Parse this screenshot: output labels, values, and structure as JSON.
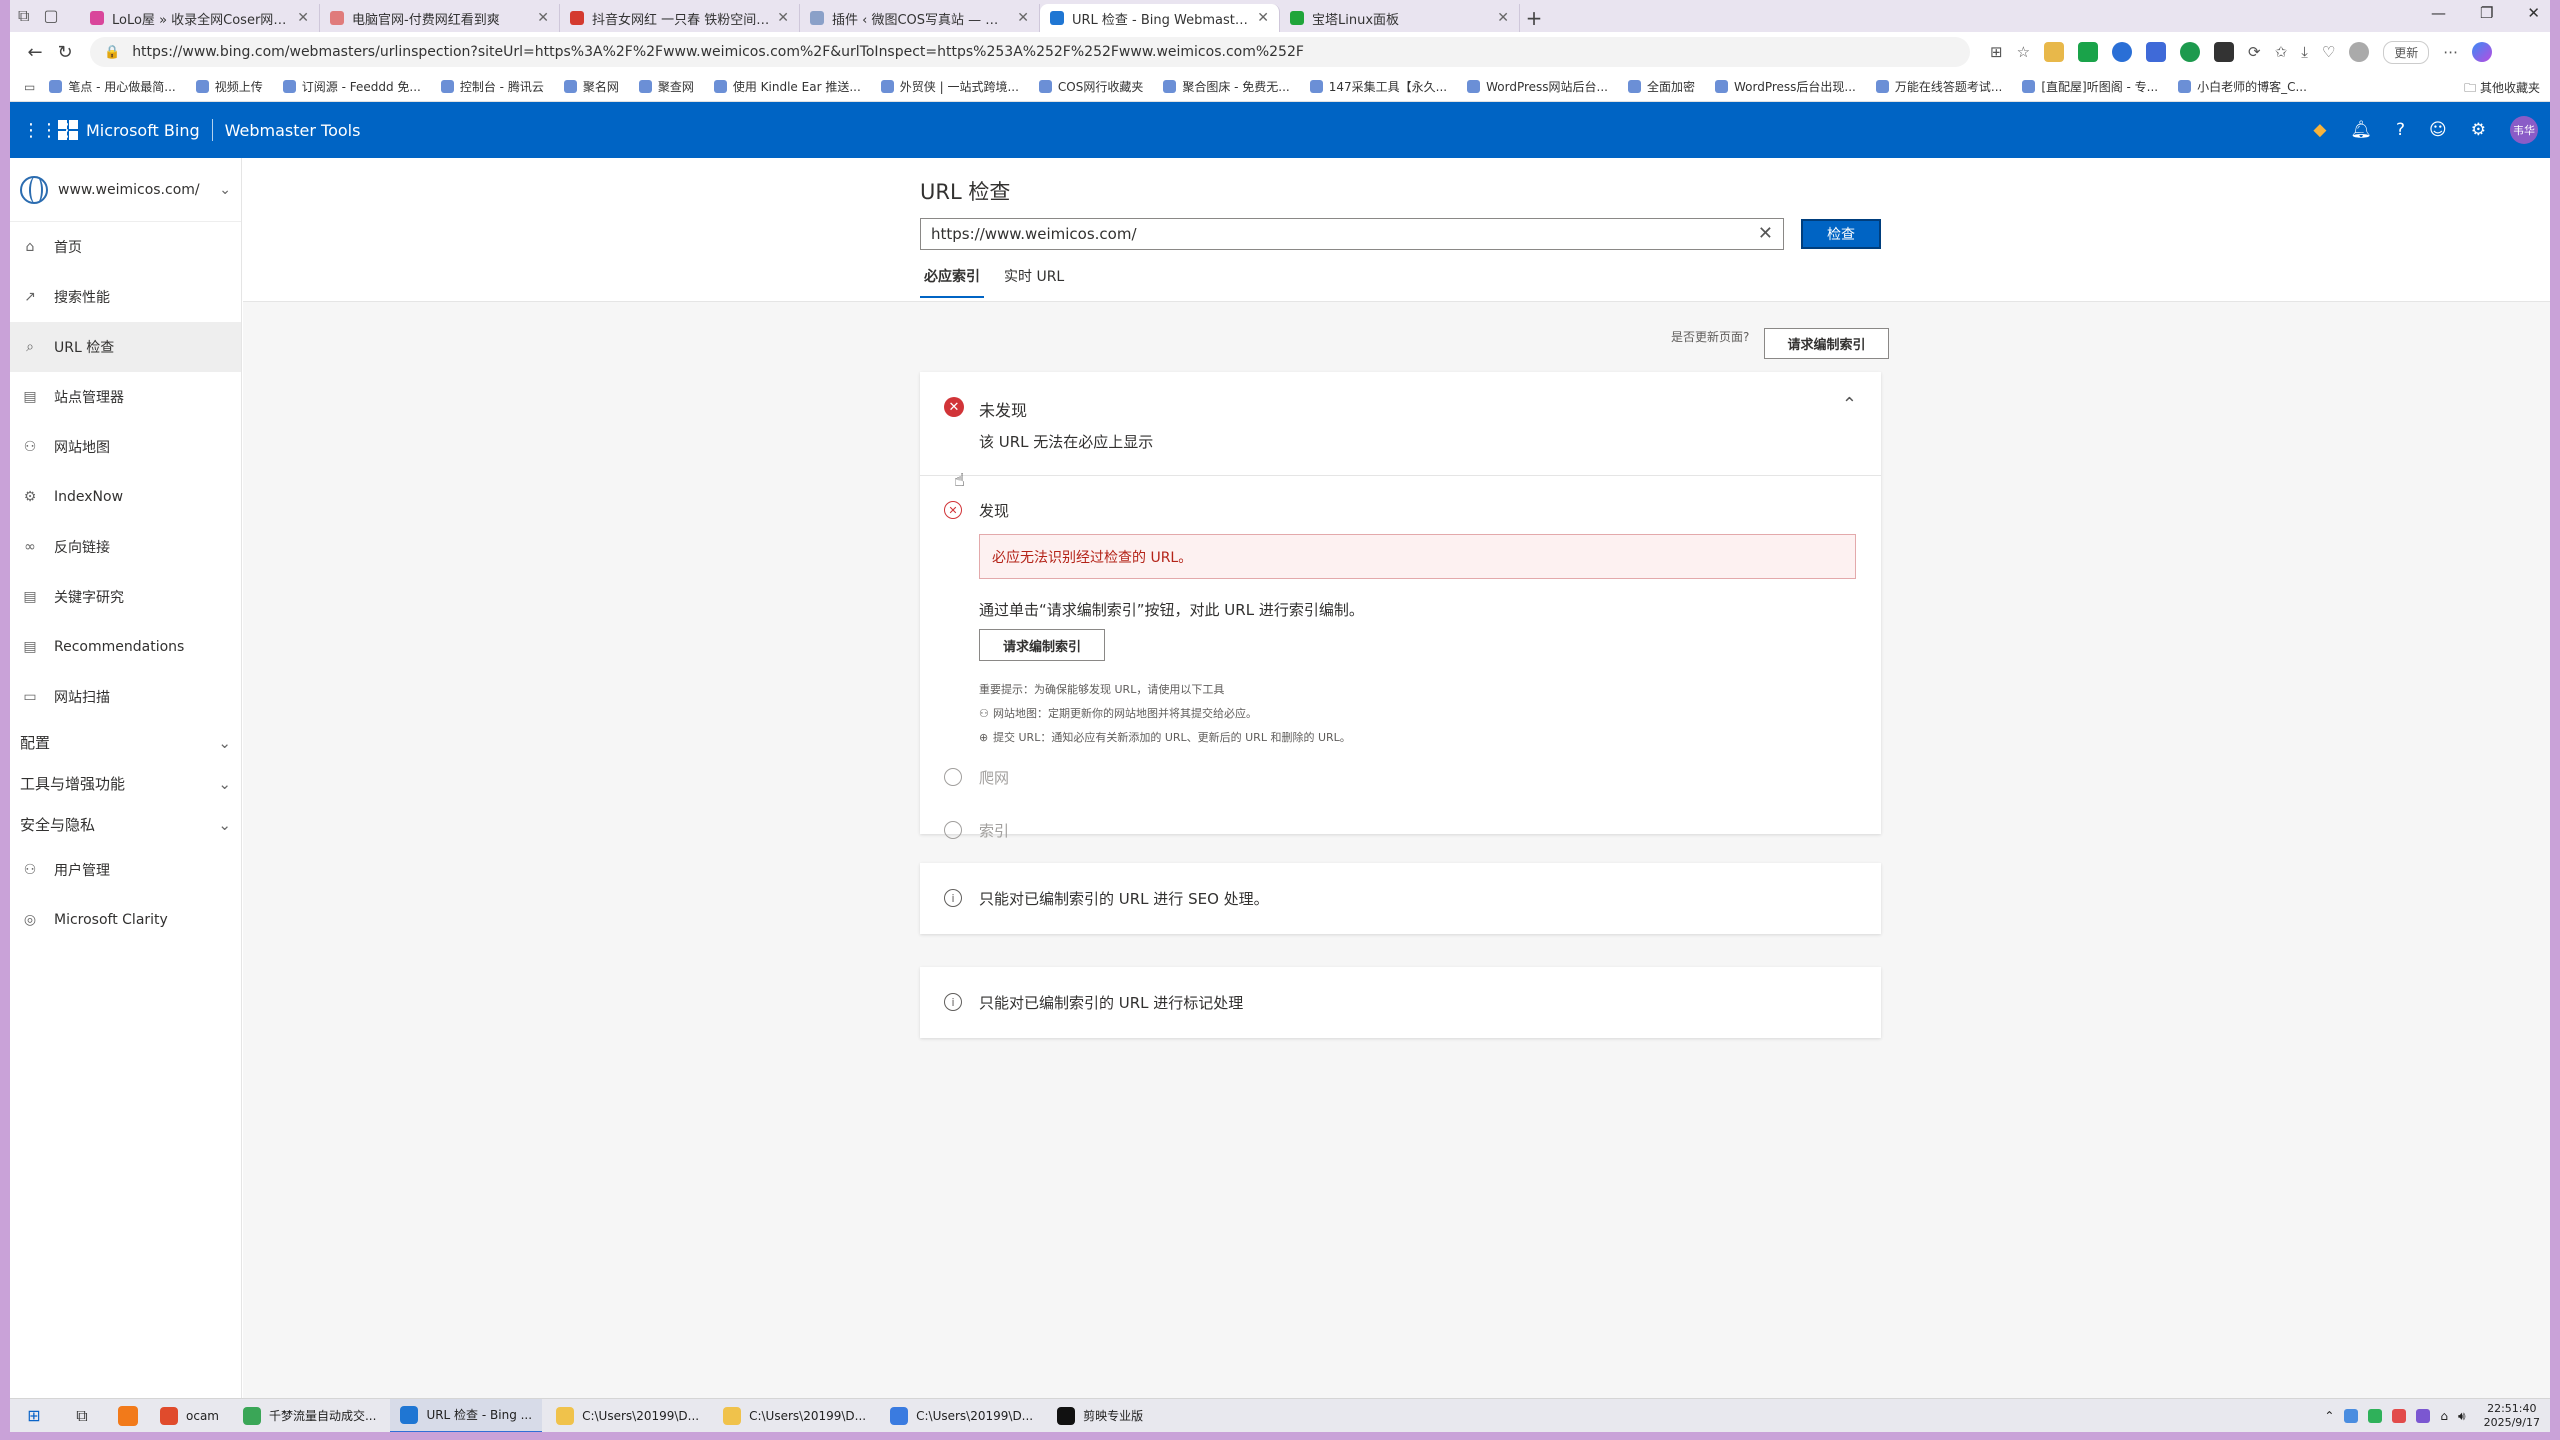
{
  "browser": {
    "tabs": [
      {
        "title": "LoLo屋 » 收录全网Coser网红写真",
        "color": "#d9469b",
        "active": false
      },
      {
        "title": "电脑官网-付费网红看到爽",
        "color": "#e07b7b",
        "active": false
      },
      {
        "title": "抖音女网红 一只春 铁粉空间 NO",
        "color": "#d43a2f",
        "active": false
      },
      {
        "title": "插件 ‹ 微图COS写真站 — WordPr",
        "color": "#8aa0c8",
        "active": false
      },
      {
        "title": "URL 检查 - Bing Webmaster Tools",
        "color": "#1f76d3",
        "active": true
      },
      {
        "title": "宝塔Linux面板",
        "color": "#20a53a",
        "active": false
      }
    ],
    "address": "https://www.bing.com/webmasters/urlinspection?siteUrl=https%3A%2F%2Fwww.weimicos.com%2F&urlToInspect=https%253A%252F%252Fwww.weimicos.com%252F",
    "update_label": "更新",
    "bookmarks": [
      "笔点 - 用心做最简...",
      "视频上传",
      "订阅源 - Feeddd 免...",
      "控制台 - 腾讯云",
      "聚名网",
      "聚查网",
      "使用 Kindle Ear 推送...",
      "外贸侠 | 一站式跨境...",
      "COS网行收藏夹",
      "聚合图床 - 免费无...",
      "147采集工具【永久...",
      "WordPress网站后台...",
      "全面加密",
      "WordPress后台出现...",
      "万能在线答题考试...",
      "[直配屋]听图阁 - 专...",
      "小白老师的博客_C..."
    ],
    "other_bookmarks": "其他收藏夹"
  },
  "header": {
    "brand": "Microsoft Bing",
    "product": "Webmaster Tools",
    "avatar_text": "韦华"
  },
  "sidebar": {
    "site": "www.weimicos.com/",
    "items": [
      {
        "label": "首页",
        "icon": "⌂",
        "active": false
      },
      {
        "label": "搜索性能",
        "icon": "↗",
        "active": false
      },
      {
        "label": "URL 检查",
        "icon": "⌕",
        "active": true
      },
      {
        "label": "站点管理器",
        "icon": "▤",
        "active": false
      },
      {
        "label": "网站地图",
        "icon": "⚇",
        "active": false
      },
      {
        "label": "IndexNow",
        "icon": "⚙",
        "active": false
      },
      {
        "label": "反向链接",
        "icon": "∞",
        "active": false
      },
      {
        "label": "关键字研究",
        "icon": "▤",
        "active": false
      },
      {
        "label": "Recommendations",
        "icon": "▤",
        "active": false
      },
      {
        "label": "网站扫描",
        "icon": "▭",
        "active": false
      }
    ],
    "groups": [
      "配置",
      "工具与增强功能",
      "安全与隐私"
    ],
    "bottom_items": [
      {
        "label": "用户管理",
        "icon": "⚇"
      },
      {
        "label": "Microsoft Clarity",
        "icon": "◎"
      }
    ]
  },
  "main": {
    "title": "URL 检查",
    "url_value": "https://www.weimicos.com/",
    "inspect_label": "检查",
    "tabs": [
      {
        "label": "必应索引",
        "active": true
      },
      {
        "label": "实时 URL",
        "active": false
      }
    ],
    "updated_question": "是否更新页面?",
    "request_index_label": "请求编制索引",
    "status_title": "未发现",
    "status_sub": "该 URL 无法在必应上显示",
    "steps": {
      "discovery": "发现",
      "crawl": "爬网",
      "index": "索引"
    },
    "error_message": "必应无法识别经过检查的 URL。",
    "description": "通过单击“请求编制索引”按钮，对此 URL 进行索引编制。",
    "tips": [
      "重要提示：为确保能够发现 URL，请使用以下工具",
      "网站地图：定期更新你的网站地图并将其提交给必应。",
      "提交 URL：通知必应有关新添加的 URL、更新后的 URL 和删除的 URL。"
    ],
    "info_seo": "只能对已编制索引的 URL 进行 SEO 处理。",
    "info_markup": "只能对已编制索引的 URL 进行标记处理"
  },
  "taskbar": {
    "apps": [
      {
        "label": "ocam",
        "color": "#e04b2c",
        "active": false
      },
      {
        "label": "千梦流量自动成交...",
        "color": "#3aa657",
        "active": false
      },
      {
        "label": "URL 检查 - Bing ...",
        "color": "#1f76d3",
        "active": true
      },
      {
        "label": "C:\\Users\\20199\\D...",
        "color": "#f0c24b",
        "active": false
      },
      {
        "label": "C:\\Users\\20199\\D...",
        "color": "#f0c24b",
        "active": false
      },
      {
        "label": "C:\\Users\\20199\\D...",
        "color": "#3a7be0",
        "active": false
      },
      {
        "label": "剪映专业版",
        "color": "#111111",
        "active": false
      }
    ],
    "time": "22:51:40",
    "date": "2025/9/17"
  }
}
